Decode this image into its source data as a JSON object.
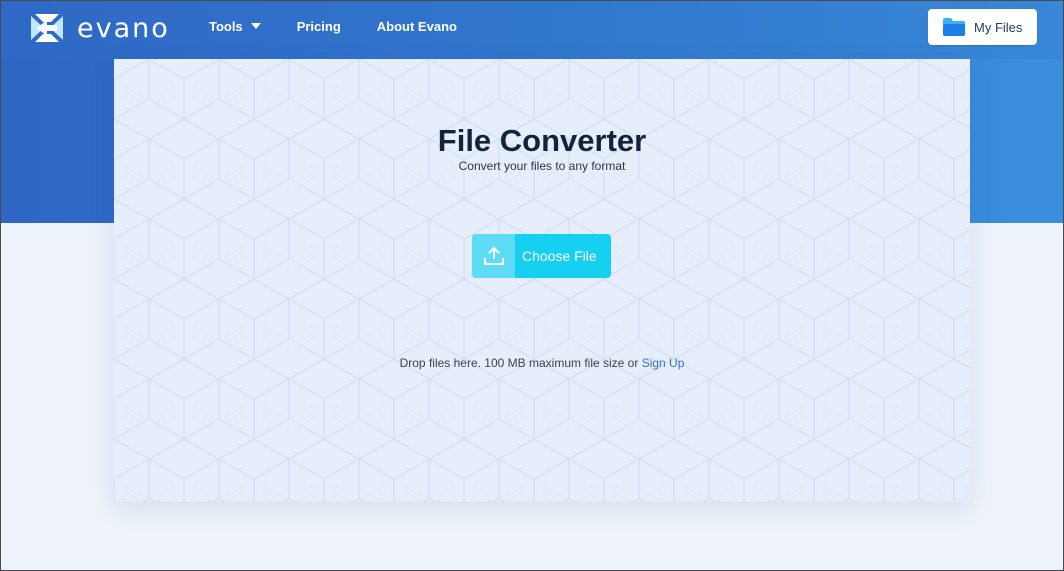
{
  "brand": {
    "name": "evano"
  },
  "nav": {
    "items": [
      {
        "label": "Tools",
        "has_dropdown": true
      },
      {
        "label": "Pricing"
      },
      {
        "label": "About Evano"
      }
    ],
    "my_files_label": "My Files"
  },
  "converter": {
    "title": "File Converter",
    "subtitle": "Convert your files to any format",
    "choose_file_label": "Choose File",
    "drop_text": "Drop files here. 100 MB maximum file size or",
    "signup_link": "Sign Up"
  },
  "icons": {
    "logo": "evano-logo-icon",
    "dropdown": "chevron-down-icon",
    "my_files": "folder-icon",
    "upload": "upload-icon"
  },
  "colors": {
    "header_blue": "#3176cd",
    "accent_cyan": "#16d0f2",
    "link_blue": "#2f72c8",
    "title_dark": "#14223a",
    "page_bg": "#eef3fb"
  }
}
